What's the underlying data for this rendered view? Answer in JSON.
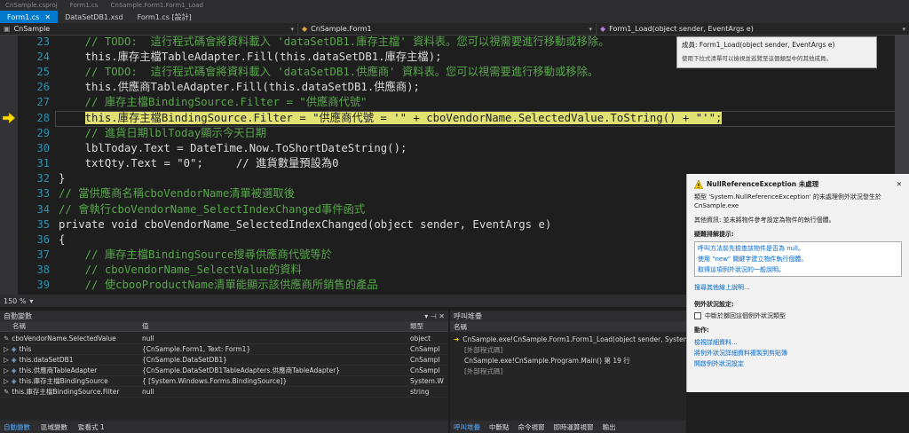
{
  "top": {
    "items": [
      "CnSample.csproj",
      "Form1.cs",
      "CnSample.Form1.Form1_Load"
    ]
  },
  "tabs": [
    {
      "label": "Form1.cs",
      "active": true
    },
    {
      "label": "DataSetDB1.xsd",
      "active": false
    },
    {
      "label": "Form1.cs [設計]",
      "active": false
    }
  ],
  "nav": {
    "project": "CnSample",
    "class": "CnSample.Form1",
    "member": "Form1_Load(object sender, EventArgs e)"
  },
  "editor": {
    "line_numbers": [
      "23",
      "24",
      "25",
      "26",
      "27",
      "28",
      "29",
      "30",
      "31",
      "32",
      "33",
      "34",
      "35",
      "36",
      "37",
      "38",
      "39"
    ],
    "lines": [
      "    // TODO:  這行程式碼會將資料載入 'dataSetDB1.庫存主檔' 資料表。您可以視需要進行移動或移除。",
      "    this.庫存主檔TableAdapter.Fill(this.dataSetDB1.庫存主檔);",
      "    // TODO:  這行程式碼會將資料載入 'dataSetDB1.供應商' 資料表。您可以視需要進行移動或移除。",
      "    this.供應商TableAdapter.Fill(this.dataSetDB1.供應商);",
      "    // 庫存主檔BindingSource.Filter = \"供應商代號\"",
      "    this.庫存主檔BindingSource.Filter = \"供應商代號 = '\" + cboVendorName.SelectedValue.ToString() + \"'\";",
      "    // 進貨日期lblToday顯示今天日期",
      "    lblToday.Text = DateTime.Now.ToShortDateString();",
      "    txtQty.Text = \"0\";     // 進貨數量預設為0",
      "}",
      "// 當供應商名稱cboVendorName清單被選取後",
      "// 會執行cboVendorName_SelectIndexChanged事件函式",
      "private void cboVendorName_SelectedIndexChanged(object sender, EventArgs e)",
      "{",
      "    // 庫存主檔BindingSource搜尋供應商代號等於",
      "    // cboVendorName_SelectValue的資料",
      "    // 使cbooProductName清單能顯示該供應商所銷售的產品"
    ]
  },
  "zoom": "150 %",
  "tooltip": {
    "title": "成員: Form1_Load(object sender, EventArgs e)",
    "hint": "使用下拉式清單可以檢視並巡覽至這個類型中的其他成員。"
  },
  "exception": {
    "title": "NullReferenceException 未處理",
    "message": "類型 'System.NullReferenceException' 的未處理例外狀況發生於 CnSample.exe",
    "detail": "其他資訊: 並未將物件參考設定為物件的執行個體。",
    "tips_title": "疑難排解提示:",
    "tips": [
      "呼叫方法前先檢查該物件是否為 null。",
      "使用 \"new\" 關鍵字建立物件執行個體。",
      "取得這項例外狀況的一般說明。"
    ],
    "more_help": "搜尋其他線上說明...",
    "settings_title": "例外狀況設定:",
    "settings_check": "中斷於擲回這個例外狀況類型",
    "actions_title": "動作:",
    "actions": [
      "檢視詳細資料...",
      "將例外狀況詳細資料複製到剪貼簿",
      "開啟例外狀況設定"
    ]
  },
  "autos": {
    "title": "自動變數",
    "col_name": "名稱",
    "col_value": "值",
    "col_type": "類型",
    "rows": [
      {
        "name": "cboVendorName.SelectedValue",
        "value": "null",
        "type": "object"
      },
      {
        "name": "this",
        "value": "{CnSample.Form1, Text: Form1}",
        "type": "CnSampl"
      },
      {
        "name": "this.dataSetDB1",
        "value": "{CnSample.DataSetDB1}",
        "type": "CnSampl"
      },
      {
        "name": "this.供應商TableAdapter",
        "value": "{CnSample.DataSetDB1TableAdapters.供應商TableAdapter}",
        "type": "CnSampl"
      },
      {
        "name": "this.庫存主檔BindingSource",
        "value": "{ [System.Windows.Forms.BindingSource]}",
        "type": "System.W"
      },
      {
        "name": "this.庫存主檔BindingSource.Filter",
        "value": "null",
        "type": "string"
      }
    ],
    "tabs": [
      "自動變數",
      "區域變數",
      "監看式 1"
    ]
  },
  "callstack": {
    "title": "呼叫堆疊",
    "col_name": "名稱",
    "rows": [
      "CnSample.exe!CnSample.Form1.Form1_Load(object sender, System.E",
      "[外部程式碼]",
      "CnSample.exe!CnSample.Program.Main() 第 19 行",
      "[外部程式碼]"
    ],
    "tabs": [
      "呼叫堆疊",
      "中斷點",
      "命令視窗",
      "即時運算視窗",
      "輸出"
    ]
  },
  "colors": {
    "accent": "#007acc",
    "highlight": "#e2e272",
    "comment": "#57a64a",
    "keyword": "#569cd6"
  }
}
